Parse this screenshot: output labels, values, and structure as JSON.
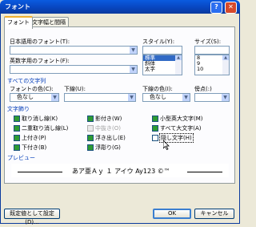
{
  "window": {
    "title": "フォント",
    "help": "?",
    "close": "✕"
  },
  "tabs": [
    {
      "label": "フォント"
    },
    {
      "label": "文字幅と間隔"
    }
  ],
  "font": {
    "japanese_label": "日本語用のフォント(T):",
    "western_label": "英数字用のフォント(F):",
    "style_label": "スタイル(Y):",
    "size_label": "サイズ(S):",
    "style_items": [
      "標準",
      "斜体",
      "太字"
    ],
    "size_items": [
      "8",
      "9",
      "10"
    ]
  },
  "all_text": {
    "section": "すべての文字列",
    "color_label": "フォントの色(C):",
    "color_value": "色なし",
    "underline_label": "下線(U):",
    "underline_color_label": "下線の色(I):",
    "underline_color_value": "色なし",
    "emphasis_label": "傍点(:)"
  },
  "effects": {
    "section": "文字飾り",
    "col1": [
      "取り消し線(K)",
      "二重取り消し線(L)",
      "上付き(P)",
      "下付き(B)"
    ],
    "col2": [
      "影付き(W)",
      "中抜き(O)",
      "浮き出し(E)",
      "浮彫り(G)"
    ],
    "col3": [
      "小型英大文字(M)",
      "すべて大文字(A)",
      "隠し文字(H)"
    ]
  },
  "preview": {
    "section": "プレビュー",
    "text": "あア亜Ａｙ １ アイウ Ay123 ©™"
  },
  "buttons": {
    "default": "既定値として設定(D)...",
    "ok": "OK",
    "cancel": "キャンセル"
  }
}
